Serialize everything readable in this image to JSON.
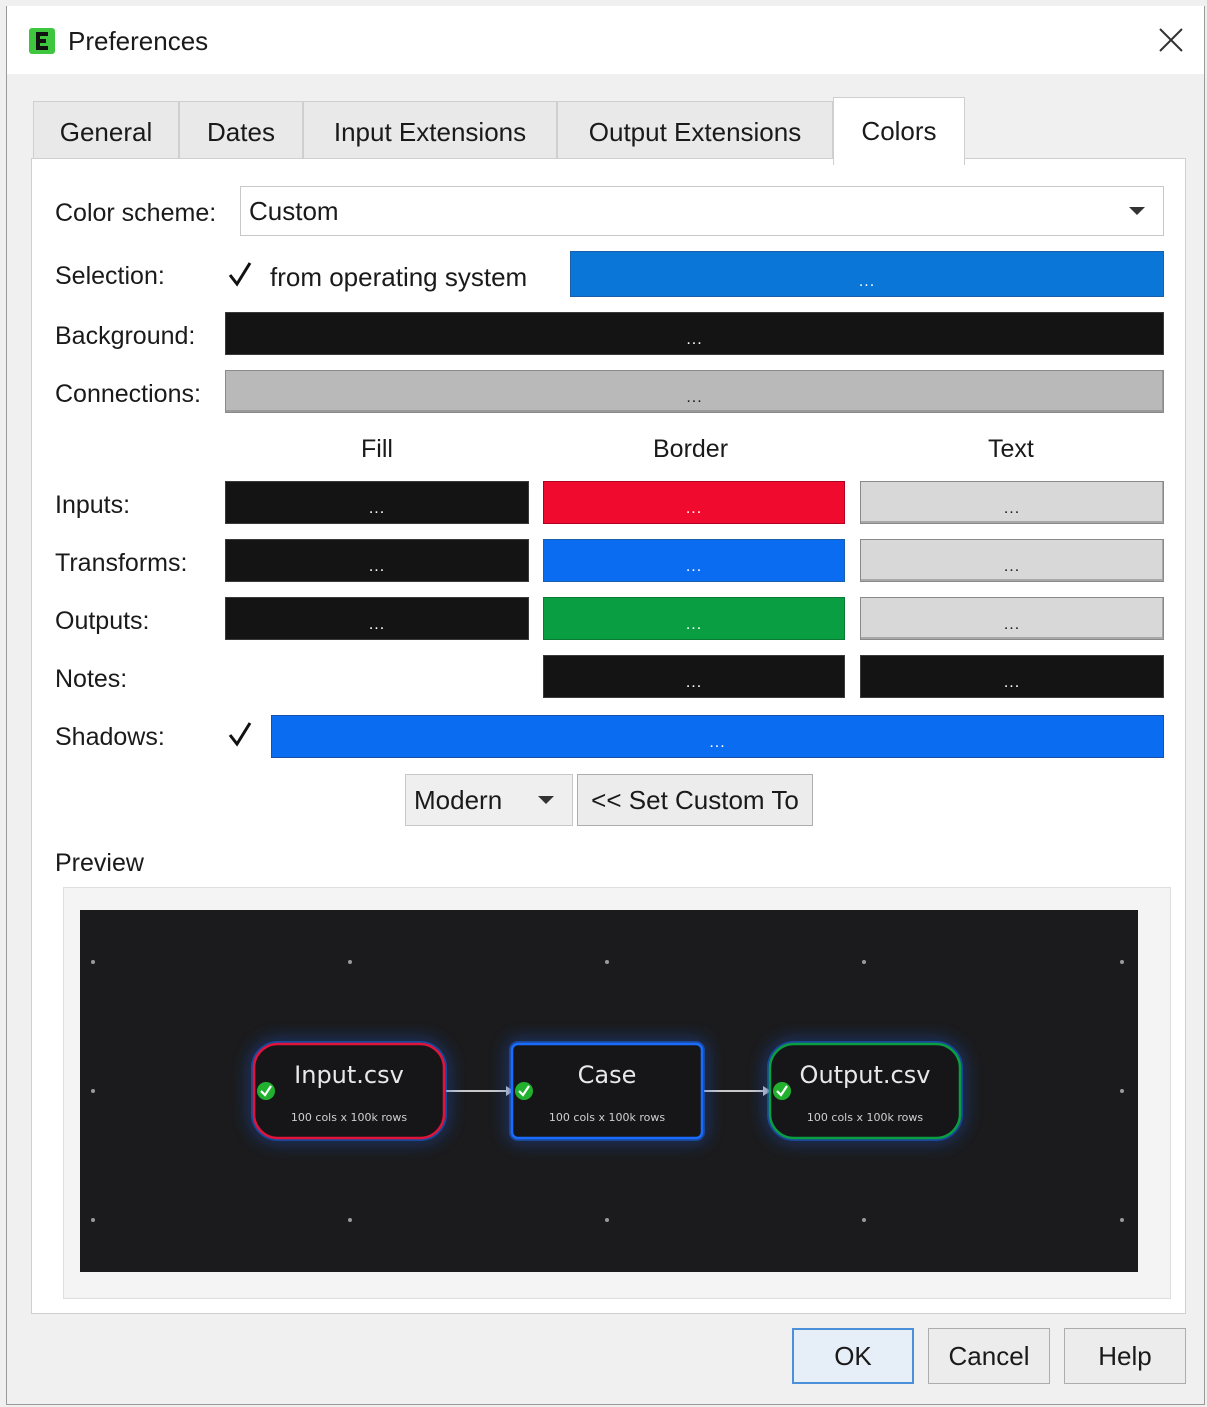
{
  "window": {
    "title": "Preferences",
    "app_icon": "easy-data-transform-icon",
    "close_icon": "close-icon"
  },
  "tabs": [
    {
      "label": "General",
      "active": false
    },
    {
      "label": "Dates",
      "active": false
    },
    {
      "label": "Input Extensions",
      "active": false
    },
    {
      "label": "Output Extensions",
      "active": false
    },
    {
      "label": "Colors",
      "active": true
    }
  ],
  "color_scheme": {
    "label": "Color scheme:",
    "value": "Custom"
  },
  "selection": {
    "label": "Selection:",
    "checkbox_checked": true,
    "checkbox_label": "from operating system",
    "button_text": "...",
    "color": "#0a76d8"
  },
  "background": {
    "label": "Background:",
    "button_text": "...",
    "color": "#141414"
  },
  "connections": {
    "label": "Connections:",
    "button_text": "...",
    "color": "#b9b9b9"
  },
  "columns": {
    "fill": "Fill",
    "border": "Border",
    "text": "Text"
  },
  "rows": {
    "inputs": {
      "label": "Inputs:",
      "fill": "#141414",
      "border": "#f00a2e",
      "text": "#d8d8d8",
      "button_text": "..."
    },
    "transforms": {
      "label": "Transforms:",
      "fill": "#141414",
      "border": "#0a6cf0",
      "text": "#d8d8d8",
      "button_text": "..."
    },
    "outputs": {
      "label": "Outputs:",
      "fill": "#141414",
      "border": "#0a9e42",
      "text": "#d8d8d8",
      "button_text": "..."
    },
    "notes": {
      "label": "Notes:",
      "border": "#141414",
      "text": "#141414",
      "button_text": "..."
    }
  },
  "shadows": {
    "label": "Shadows:",
    "checkbox_checked": true,
    "button_text": "...",
    "color": "#0a6cf0"
  },
  "preset": {
    "value": "Modern",
    "set_button": "<< Set Custom To"
  },
  "preview": {
    "label": "Preview",
    "nodes": [
      {
        "title": "Input.csv",
        "subtitle": "100 cols x 100k rows",
        "kind": "input"
      },
      {
        "title": "Case",
        "subtitle": "100 cols x 100k rows",
        "kind": "transform"
      },
      {
        "title": "Output.csv",
        "subtitle": "100 cols x 100k rows",
        "kind": "output"
      }
    ]
  },
  "buttons": {
    "ok": "OK",
    "cancel": "Cancel",
    "help": "Help"
  }
}
